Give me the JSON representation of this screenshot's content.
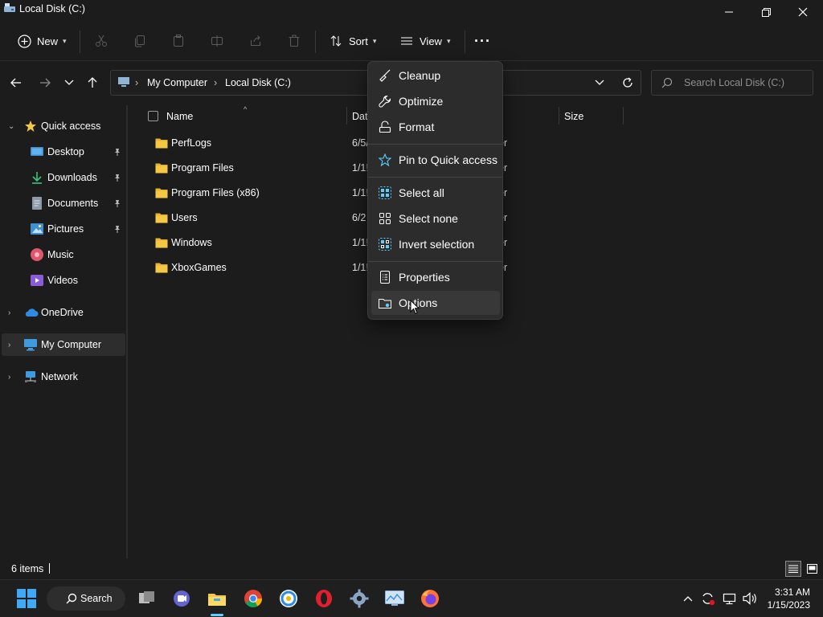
{
  "window": {
    "title": "Local Disk (C:)"
  },
  "toolbar": {
    "new_label": "New",
    "sort_label": "Sort",
    "view_label": "View",
    "more_label": "···"
  },
  "address": {
    "crumbs": [
      "My Computer",
      "Local Disk (C:)"
    ],
    "search_placeholder": "Search Local Disk (C:)"
  },
  "sidebar": {
    "quick_access": "Quick access",
    "items": [
      {
        "label": "Desktop",
        "pinned": true,
        "icon": "desktop-icon"
      },
      {
        "label": "Downloads",
        "pinned": true,
        "icon": "download-icon"
      },
      {
        "label": "Documents",
        "pinned": true,
        "icon": "document-icon"
      },
      {
        "label": "Pictures",
        "pinned": true,
        "icon": "picture-icon"
      },
      {
        "label": "Music",
        "pinned": false,
        "icon": "music-icon"
      },
      {
        "label": "Videos",
        "pinned": false,
        "icon": "video-icon"
      }
    ],
    "onedrive": "OneDrive",
    "my_computer": "My Computer",
    "network": "Network"
  },
  "columns": {
    "name": "Name",
    "date": "Dat",
    "size": "Size"
  },
  "files": [
    {
      "name": "PerfLogs",
      "date": "6/5/",
      "type": "er"
    },
    {
      "name": "Program Files",
      "date": "1/1!",
      "type": "er"
    },
    {
      "name": "Program Files (x86)",
      "date": "1/1!",
      "type": "er"
    },
    {
      "name": "Users",
      "date": "6/2",
      "type": "er"
    },
    {
      "name": "Windows",
      "date": "1/1!",
      "type": "er"
    },
    {
      "name": "XboxGames",
      "date": "1/1!",
      "type": "er"
    }
  ],
  "menu": {
    "items": [
      "Cleanup",
      "Optimize",
      "Format",
      "Pin to Quick access",
      "Select all",
      "Select none",
      "Invert selection",
      "Properties",
      "Options"
    ],
    "hovered": "Options"
  },
  "status": {
    "item_count": "6 items"
  },
  "taskbar": {
    "search_label": "Search",
    "time": "3:31 AM",
    "date": "1/15/2023"
  },
  "colors": {
    "background": "#1c1c1c",
    "menu_bg": "#2c2c2c",
    "folder": "#f4c842",
    "accent": "#60cdff"
  }
}
